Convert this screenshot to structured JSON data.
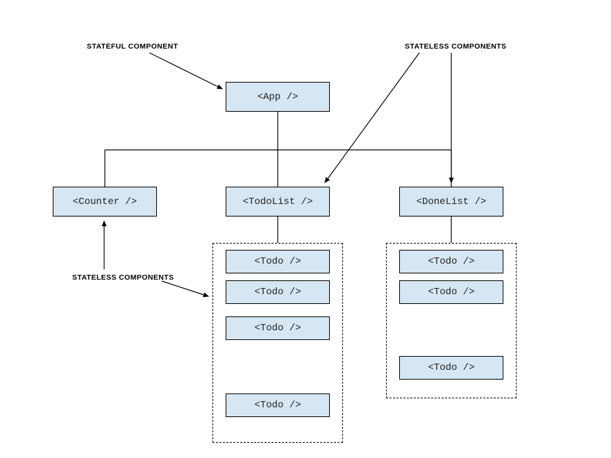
{
  "labels": {
    "stateful": "STATEFUL COMPONENT",
    "stateless_right": "STATELESS COMPONENTS",
    "stateless_left": "STATELESS COMPONENTS"
  },
  "nodes": {
    "app": "<App />",
    "counter": "<Counter />",
    "todolist": "<TodoList />",
    "donelist": "<DoneList />",
    "todo1": "<Todo />",
    "todo2": "<Todo />",
    "todo3": "<Todo />",
    "todo4": "<Todo />",
    "done_todo1": "<Todo />",
    "done_todo2": "<Todo />",
    "done_todo3": "<Todo />"
  },
  "colors": {
    "node_fill": "#d6e6f2",
    "border": "#000000"
  }
}
